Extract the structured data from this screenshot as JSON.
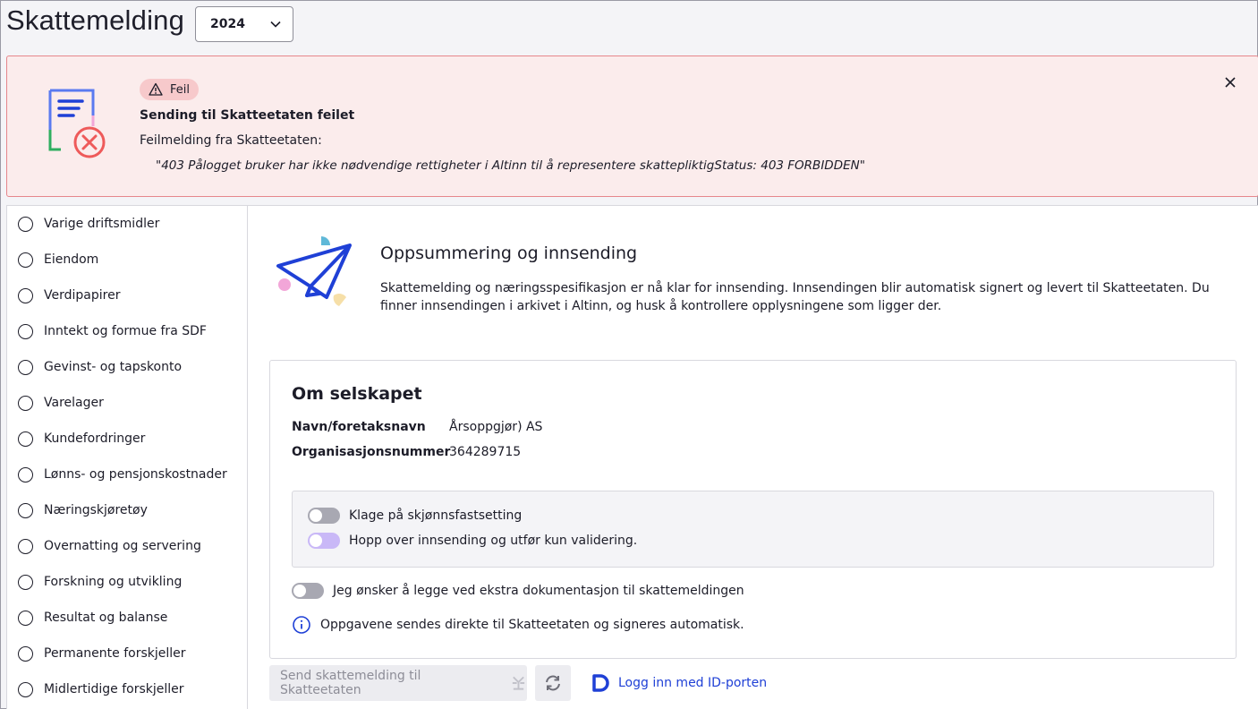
{
  "header": {
    "title": "Skattemelding",
    "year_select": {
      "value": "2024"
    }
  },
  "alert": {
    "badge": "Feil",
    "title": "Sending til Skatteetaten feilet",
    "subtitle": "Feilmelding fra Skatteetaten:",
    "message": "\"403 Pålogget bruker har ikke nødvendige rettigheter i Altinn til å representere skattepliktigStatus: 403 FORBIDDEN\"",
    "colors": {
      "background": "#fbecec",
      "border": "#e6868c",
      "error": "#ee5a5a"
    }
  },
  "sidebar": {
    "items": [
      {
        "label": "Varige driftsmidler"
      },
      {
        "label": "Eiendom"
      },
      {
        "label": "Verdipapirer"
      },
      {
        "label": "Inntekt og formue fra SDF"
      },
      {
        "label": "Gevinst- og tapskonto"
      },
      {
        "label": "Varelager"
      },
      {
        "label": "Kundefordringer"
      },
      {
        "label": "Lønns- og pensjonskostnader"
      },
      {
        "label": "Næringskjøretøy"
      },
      {
        "label": "Overnatting og servering"
      },
      {
        "label": "Forskning og utvikling"
      },
      {
        "label": "Resultat og balanse"
      },
      {
        "label": "Permanente forskjeller"
      },
      {
        "label": "Midlertidige forskjeller"
      }
    ]
  },
  "main": {
    "summary_title": "Oppsummering og innsending",
    "summary_text": "Skattemelding og næringsspesifikasjon er nå klar for innsending. Innsendingen blir automatisk signert og levert til Skatteetaten. Du finner innsendingen i arkivet i Altinn, og husk å kontrollere opplysningene som ligger der.",
    "company": {
      "title": "Om selskapet",
      "name_label": "Navn/foretaksnavn",
      "name_value": "Årsoppgjør) AS",
      "org_label": "Organisasjonsnummer",
      "org_value": "364289715"
    },
    "toggles": {
      "klage": {
        "label": "Klage på skjønnsfastsetting",
        "on": false
      },
      "hopp": {
        "label": "Hopp over innsending og utfør kun validering.",
        "on": false
      },
      "dokumentasjon": {
        "label": "Jeg ønsker å legge ved ekstra dokumentasjon til skattemeldingen",
        "on": false
      }
    },
    "info": "Oppgavene sendes direkte til Skatteetaten og signeres automatisk.",
    "actions": {
      "send_label": "Send skattemelding til Skatteetaten",
      "login_label": "Logg inn med ID-porten"
    },
    "colors": {
      "accent": "#1f40d6"
    }
  }
}
